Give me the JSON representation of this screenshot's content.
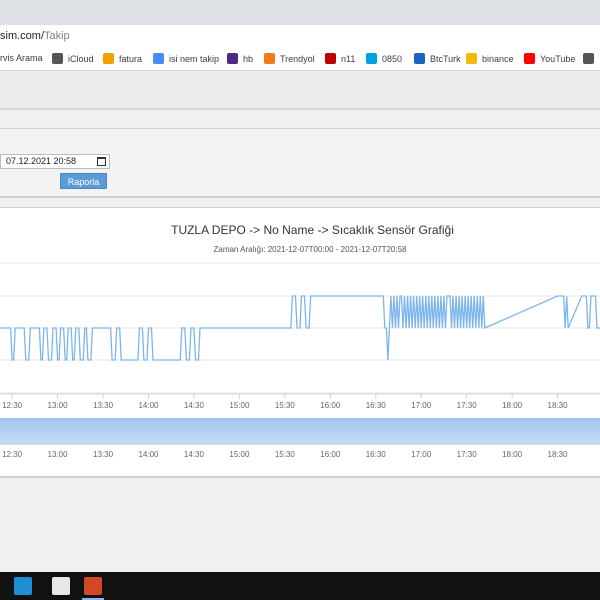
{
  "browser": {
    "url_host": "sim.com/",
    "url_path": "Takip"
  },
  "bookmarks": [
    {
      "label": "rvis Arama",
      "icon": "folder-icon",
      "color": "#888888"
    },
    {
      "label": "iCloud",
      "icon": "apple-icon",
      "color": "#555555"
    },
    {
      "label": "fatura",
      "icon": "fatura-icon",
      "color": "#f4a100"
    },
    {
      "label": "isi nem takip",
      "icon": "translate-icon",
      "color": "#4a8af4"
    },
    {
      "label": "hb",
      "icon": "hb-icon",
      "color": "#4b2a86"
    },
    {
      "label": "Trendyol",
      "icon": "trendyol-icon",
      "color": "#f27a1a"
    },
    {
      "label": "n11",
      "icon": "n11-icon",
      "color": "#c00000"
    },
    {
      "label": "0850",
      "icon": "salesforce-icon",
      "color": "#00a1e0"
    },
    {
      "label": "BtcTurk",
      "icon": "btcturk-icon",
      "color": "#1a62c8"
    },
    {
      "label": "binance",
      "icon": "binance-icon",
      "color": "#f0b90b"
    },
    {
      "label": "YouTube",
      "icon": "youtube-icon",
      "color": "#ff0000"
    },
    {
      "label": "",
      "icon": "globe-icon",
      "color": "#555555"
    }
  ],
  "form": {
    "end_date_value": "07.12.2021 20:58",
    "report_button": "Raporla"
  },
  "chart_data": {
    "type": "line",
    "title": "TUZLA DEPO -> No Name -> Sıcaklık Sensör Grafiği",
    "subtitle": "Zaman Aralığı: 2021-12-07T00:00 - 2021-12-07T20:58",
    "x_tick_labels": [
      "12:30",
      "13:00",
      "13:30",
      "14:00",
      "14:30",
      "15:00",
      "15:30",
      "16:00",
      "16:30",
      "17:00",
      "17:30",
      "18:00",
      "18:30"
    ],
    "x_range_minutes": [
      742,
      1138
    ],
    "y_levels": [
      "low",
      "mid",
      "high"
    ],
    "grid": true,
    "series_color": "#7cb5ec",
    "series": [
      {
        "x_minutes": [
          742,
          749,
          750,
          751,
          752,
          758,
          759,
          761,
          762,
          768,
          769,
          770,
          771,
          773,
          774,
          776,
          777,
          779,
          780,
          781,
          782,
          784,
          785,
          786,
          787,
          789,
          790,
          791,
          792,
          794,
          795,
          797,
          798,
          799,
          800,
          802,
          803,
          815,
          816,
          818,
          819,
          821,
          822,
          833,
          834,
          836,
          837,
          839,
          840,
          842,
          843,
          861,
          862,
          864,
          865,
          867,
          868,
          870,
          871,
          873,
          874,
          934,
          935,
          937,
          938,
          940,
          941,
          943,
          944,
          946,
          947,
          995,
          996,
          997,
          998,
          999,
          1000,
          1001,
          1002,
          1003,
          1004,
          1005,
          1006,
          1007,
          1008,
          1009,
          1010,
          1011,
          1012,
          1013,
          1014,
          1015,
          1016,
          1017,
          1018,
          1019,
          1020,
          1021,
          1022,
          1023,
          1024,
          1025,
          1026,
          1027,
          1028,
          1029,
          1030,
          1031,
          1032,
          1033,
          1034,
          1035,
          1036,
          1037,
          1039,
          1040,
          1041,
          1042,
          1043,
          1044,
          1045,
          1046,
          1047,
          1048,
          1049,
          1050,
          1051,
          1052,
          1053,
          1054,
          1055,
          1056,
          1057,
          1058,
          1059,
          1060,
          1061,
          1062,
          1110,
          1111,
          1114,
          1115,
          1116,
          1117,
          1126,
          1127,
          1129,
          1130,
          1131,
          1132,
          1135,
          1136,
          1138
        ],
        "y_levels": [
          1,
          1,
          0,
          0,
          1,
          1,
          0,
          0,
          1,
          1,
          0,
          0,
          1,
          1,
          0,
          0,
          1,
          1,
          0,
          0,
          1,
          1,
          0,
          0,
          1,
          1,
          0,
          0,
          1,
          1,
          0,
          0,
          1,
          1,
          0,
          0,
          1,
          1,
          0,
          0,
          1,
          1,
          0,
          0,
          1,
          1,
          0,
          0,
          1,
          1,
          0,
          0,
          1,
          1,
          0,
          0,
          1,
          1,
          0,
          0,
          1,
          1,
          2,
          2,
          1,
          1,
          2,
          2,
          1,
          1,
          2,
          2,
          1,
          1,
          0,
          1,
          2,
          1,
          2,
          1,
          2,
          1,
          2,
          2,
          1,
          2,
          1,
          2,
          1,
          2,
          1,
          2,
          1,
          2,
          1,
          2,
          1,
          2,
          1,
          2,
          1,
          2,
          1,
          2,
          1,
          2,
          1,
          2,
          1,
          2,
          1,
          2,
          1,
          2,
          2,
          1,
          2,
          1,
          2,
          1,
          2,
          1,
          2,
          1,
          2,
          1,
          2,
          1,
          2,
          1,
          2,
          1,
          2,
          1,
          2,
          1,
          2,
          1,
          2,
          2,
          2,
          1,
          2,
          1,
          2,
          2,
          2,
          1,
          1,
          2,
          2,
          1,
          1,
          2,
          2
        ]
      }
    ]
  },
  "taskbar": {
    "apps": [
      {
        "name": "sticky-notes-icon",
        "color": "#1e8fd6"
      },
      {
        "name": "paint-icon",
        "color": "#e8e8e8"
      },
      {
        "name": "powerpoint-icon",
        "color": "#d24726"
      }
    ]
  }
}
